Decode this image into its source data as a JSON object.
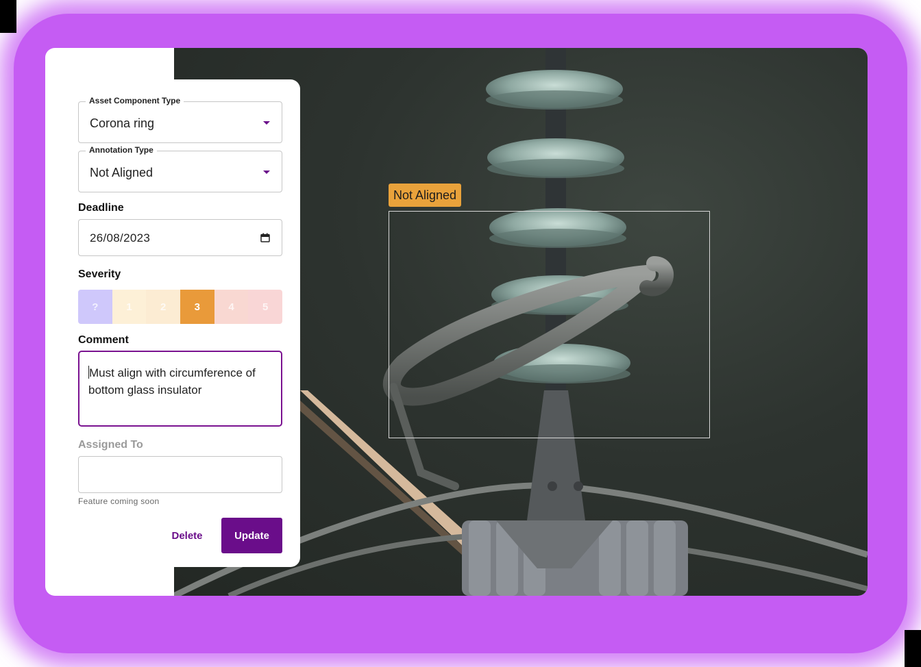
{
  "form": {
    "asset_component_type": {
      "label": "Asset Component Type",
      "value": "Corona ring"
    },
    "annotation_type": {
      "label": "Annotation Type",
      "value": "Not Aligned"
    },
    "deadline": {
      "label": "Deadline",
      "value": "26/08/2023"
    },
    "severity": {
      "label": "Severity",
      "options": [
        "?",
        "1",
        "2",
        "3",
        "4",
        "5"
      ],
      "colors": [
        "#cfc8fb",
        "#fdf0d7",
        "#fcecd3",
        "#e99a3a",
        "#f9d8d2",
        "#f9d6d6"
      ],
      "selected": "3"
    },
    "comment": {
      "label": "Comment",
      "value": "Must align with circumference of bottom glass insulator"
    },
    "assigned_to": {
      "label": "Assigned To",
      "value": "",
      "helper": "Feature coming soon"
    },
    "buttons": {
      "delete": "Delete",
      "update": "Update"
    }
  },
  "annotation": {
    "label": "Not Aligned",
    "color": "#e9a23b"
  },
  "colors": {
    "accent": "#6a0d8a",
    "glow": "#c55cf3"
  }
}
